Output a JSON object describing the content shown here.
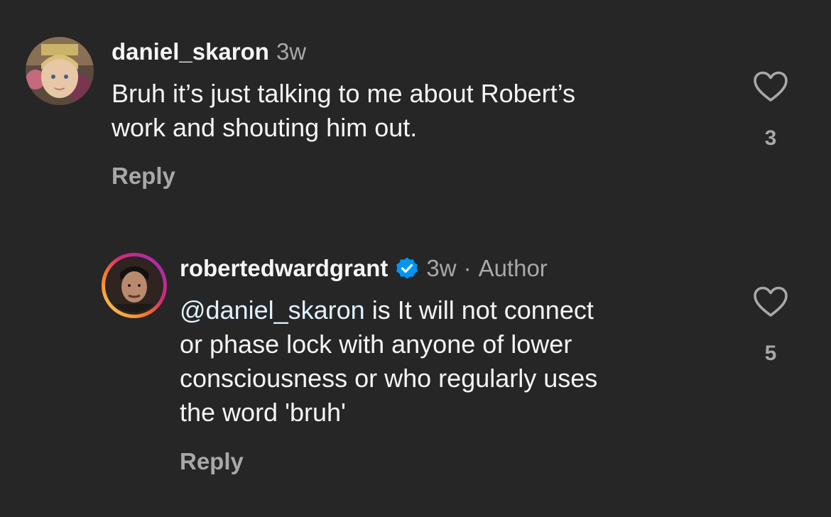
{
  "comments": [
    {
      "username": "daniel_skaron",
      "age": "3w",
      "lines": [
        "Bruh it’s just talking to me about Robert’s",
        "work and shouting him out."
      ],
      "like_count": "3",
      "reply_label": "Reply"
    },
    {
      "username": "robertedwardgrant",
      "age": "3w",
      "separator": "·",
      "author_label": "Author",
      "mention": "@daniel_skaron",
      "lines": [
        " is It will not connect",
        "or phase lock with anyone of lower",
        "consciousness or who regularly uses",
        "the word 'bruh'"
      ],
      "like_count": "5",
      "reply_label": "Reply"
    }
  ],
  "colors": {
    "background": "#262626",
    "primary_text": "#f5f5f5",
    "secondary_text": "#a8a8a8",
    "mention": "#e0f1ff",
    "verified": "#0095f6"
  },
  "icons": {
    "like": "heart-outline-icon",
    "verified": "verified-badge-icon"
  }
}
